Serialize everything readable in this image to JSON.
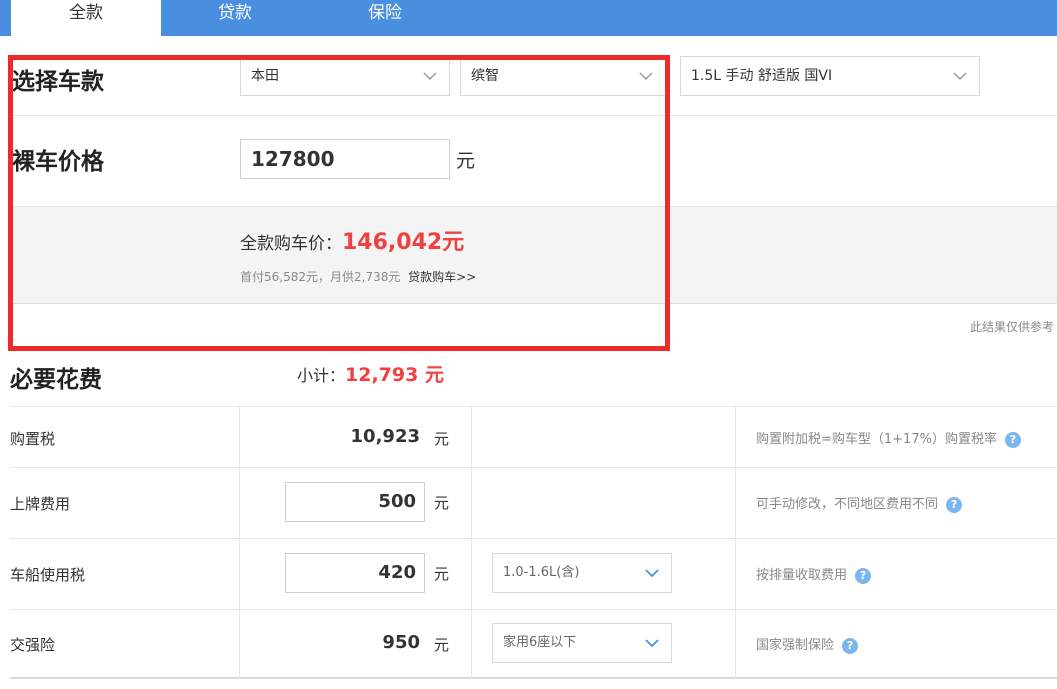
{
  "tabs": [
    {
      "label": "全款"
    },
    {
      "label": "贷款"
    },
    {
      "label": "保险"
    }
  ],
  "car_select": {
    "label": "选择车款",
    "brand": "本田",
    "model": "缤智",
    "trim": "1.5L 手动 舒适版 国VI"
  },
  "price": {
    "label": "裸车价格",
    "value": "127800",
    "unit": "元"
  },
  "result": {
    "total_label": "全款购车价：",
    "total_value": "146,042元",
    "sub_text": "首付56,582元，月供2,738元",
    "loan_link": "贷款购车>>"
  },
  "disclaimer": "此结果仅供参考",
  "required": {
    "title": "必要花费",
    "subtotal_label": "小计：",
    "subtotal_value": "12,793 元",
    "rows": [
      {
        "label": "购置税",
        "amount": "10,923",
        "unit": "元",
        "note": "购置附加税=购车型（1+17%）购置税率"
      },
      {
        "label": "上牌费用",
        "amount": "500",
        "unit": "元",
        "note": "可手动修改，不同地区费用不同"
      },
      {
        "label": "车船使用税",
        "amount": "420",
        "unit": "元",
        "option": "1.0-1.6L(含)",
        "note": "按排量收取费用"
      },
      {
        "label": "交强险",
        "amount": "950",
        "unit": "元",
        "option": "家用6座以下",
        "note": "国家强制保险"
      }
    ]
  },
  "colors": {
    "tab_bar": "#4a8ee0",
    "accent_red": "#f04040",
    "highlight_box": "#ee2a2a",
    "help_icon": "#7db6ee"
  }
}
